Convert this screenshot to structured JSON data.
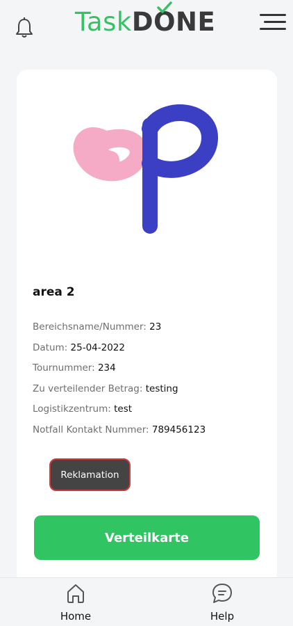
{
  "header": {
    "logo_part1": "Task",
    "logo_part2": "DONE"
  },
  "card": {
    "title": "area 2",
    "info": [
      {
        "label": "Bereichsname/Nummer:",
        "value": "23"
      },
      {
        "label": "Datum:",
        "value": "25-04-2022"
      },
      {
        "label": "Tournummer:",
        "value": "234"
      },
      {
        "label": "Zu verteilender Betrag:",
        "value": "testing"
      },
      {
        "label": "Logistikzentrum:",
        "value": "test"
      },
      {
        "label": "Notfall Kontakt Nummer:",
        "value": "789456123"
      }
    ],
    "reklamation_label": "Reklamation",
    "verteilkarte_label": "Verteilkarte"
  },
  "nav": {
    "home_label": "Home",
    "help_label": "Help"
  },
  "colors": {
    "brand_green": "#30c462",
    "logo_pink": "#f4a6c2",
    "logo_blue": "#3b3fc4"
  }
}
